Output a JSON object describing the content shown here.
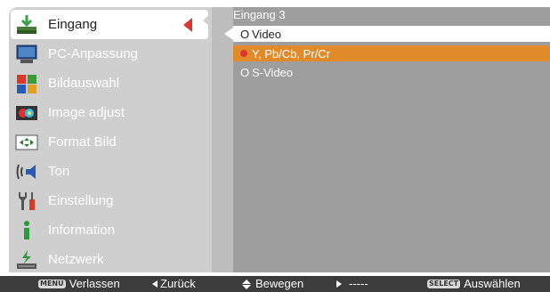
{
  "sidebar": {
    "items": [
      {
        "label": "Eingang",
        "icon": "input-arrow-icon",
        "active": true
      },
      {
        "label": "PC-Anpassung",
        "icon": "monitor-icon",
        "active": false
      },
      {
        "label": "Bildauswahl",
        "icon": "picture-select-icon",
        "active": false
      },
      {
        "label": "Image adjust",
        "icon": "color-adjust-icon",
        "active": false
      },
      {
        "label": "Format Bild",
        "icon": "aspect-ratio-icon",
        "active": false
      },
      {
        "label": "Ton",
        "icon": "speaker-icon",
        "active": false
      },
      {
        "label": "Einstellung",
        "icon": "wrench-icon",
        "active": false
      },
      {
        "label": "Information",
        "icon": "info-icon",
        "active": false
      },
      {
        "label": "Netzwerk",
        "icon": "network-icon",
        "active": false
      }
    ]
  },
  "panel": {
    "title": "Eingang 3",
    "options": [
      {
        "mark": "O",
        "label": "Video",
        "state": "current"
      },
      {
        "mark": "●",
        "label": "Y, Pb/Cb, Pr/Cr",
        "state": "highlighted"
      },
      {
        "mark": "O",
        "label": "S-Video",
        "state": "normal"
      }
    ]
  },
  "bottombar": {
    "menu_key": "MENU",
    "menu_label": "Verlassen",
    "back_label": "Zurück",
    "move_label": "Bewegen",
    "next_label": "-----",
    "select_key": "SELECT",
    "select_label": "Auswählen"
  },
  "colors": {
    "sidebar_bg": "#cfcfcf",
    "panel_bg": "#9e9e9e",
    "highlight": "#e08a2a",
    "arrow_red": "#e0352b",
    "bottombar_bg": "#3c3c3c"
  }
}
